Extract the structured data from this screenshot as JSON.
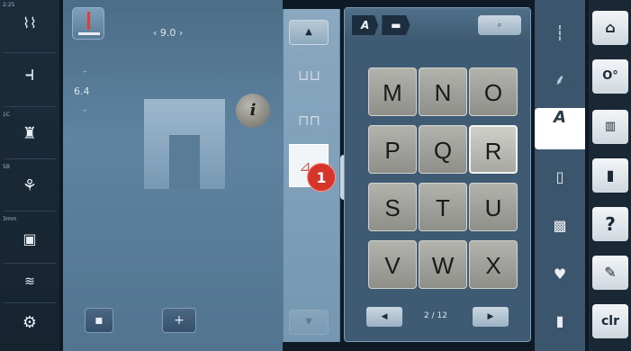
{
  "left_column": {
    "time_label": "2:25",
    "indicator_1c": "1C",
    "indicator_5b": "5B",
    "indicator_3mm": "3mm"
  },
  "work_area": {
    "stitch_width": "‹ 9.0 ›",
    "stitch_length": "6.4",
    "info_label": "i",
    "add_label": "+"
  },
  "strip": {
    "up_label": "▲",
    "down_label": "▼",
    "cells": [
      "⊔⊔",
      "⊓⊓",
      "⊿"
    ]
  },
  "callout": {
    "number": "1"
  },
  "panel": {
    "tabs": [
      "A",
      "▬"
    ],
    "search_label": "⌕",
    "letters": [
      "M",
      "N",
      "O",
      "P",
      "Q",
      "R",
      "S",
      "T",
      "U",
      "V",
      "W",
      "X"
    ],
    "selected_letter": "R",
    "page_indicator": "2 / 12",
    "prev_label": "◀",
    "next_label": "▶"
  },
  "categories": {
    "active_label": "A"
  },
  "right_column": {
    "home_label": "⌂",
    "settings_label": "O°",
    "tutorial_label": "▥",
    "consultant_label": "▮",
    "help_label": "?",
    "eco_label": "✎",
    "clr_label": "clr"
  },
  "colors": {
    "accent_red": "#d6352c",
    "panel_blue": "#3f5b73",
    "key_gray": "#a3a39d"
  }
}
